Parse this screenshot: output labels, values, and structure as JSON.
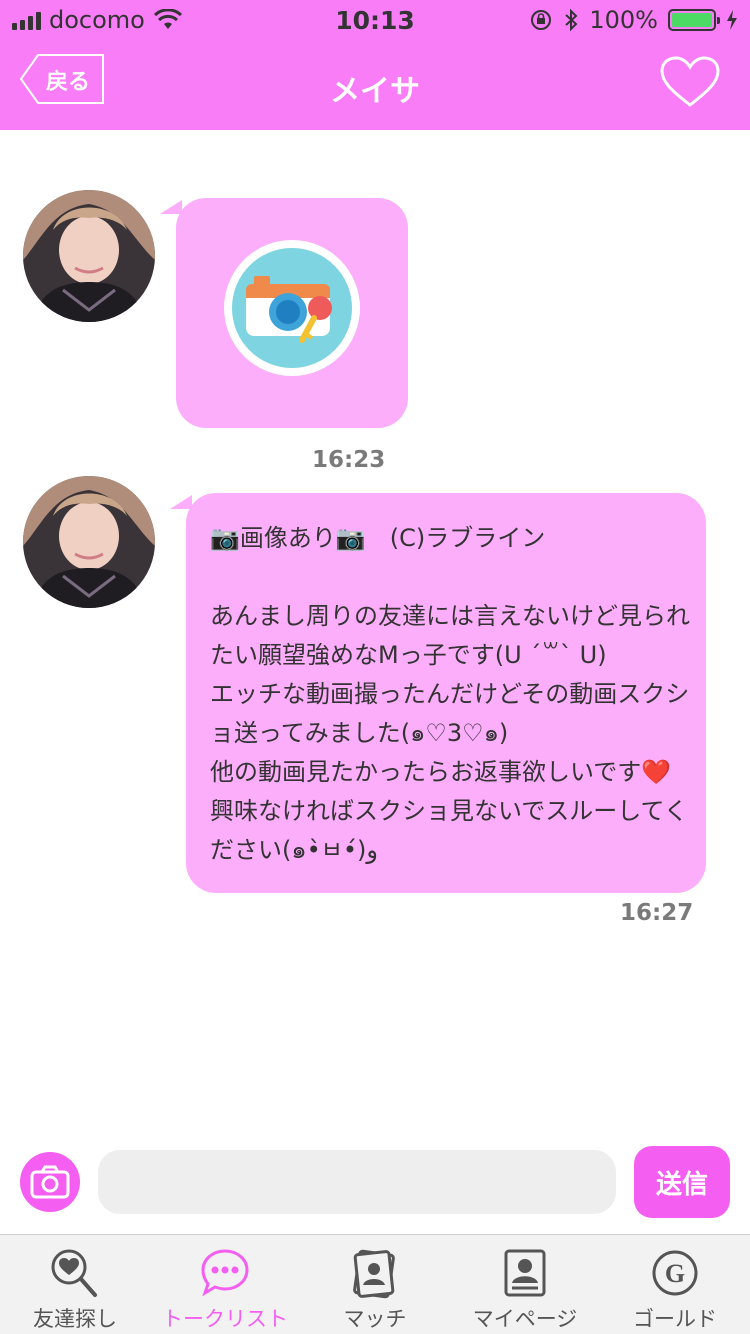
{
  "status_bar": {
    "carrier": "docomo",
    "time": "10:13",
    "battery_percent": "100%",
    "battery_level": 1.0
  },
  "nav": {
    "back_label": "戻る",
    "title": "メイサ",
    "favorite_icon": "heart-outline-icon"
  },
  "messages": [
    {
      "type": "image",
      "image_icon": "locked-camera-icon",
      "time": "16:23"
    },
    {
      "type": "text",
      "text": "📷画像あり📷　(C)ラブライン\n\nあんまし周りの友達には言えないけど見られたい願望強めなMっ子です(U ´꒳` U)\nエッチな動画撮ったんだけどその動画スクショ送ってみました(๑♡3♡๑)\n他の動画見たかったらお返事欲しいです❤️興味なければスクショ見ないでスルーしてください(๑•̀ㅂ•́)و",
      "time": "16:27"
    }
  ],
  "input_bar": {
    "camera_icon": "camera-icon",
    "message_value": "",
    "message_placeholder": "",
    "send_label": "送信"
  },
  "tabs": [
    {
      "label": "友達探し",
      "icon": "heart-search-icon",
      "active": false
    },
    {
      "label": "トークリスト",
      "icon": "chat-bubble-icon",
      "active": true
    },
    {
      "label": "マッチ",
      "icon": "cards-icon",
      "active": false
    },
    {
      "label": "マイページ",
      "icon": "profile-icon",
      "active": false
    },
    {
      "label": "ゴールド",
      "icon": "gold-coin-icon",
      "active": false
    }
  ],
  "colors": {
    "header_pink": "#f97df7",
    "bubble_pink": "#fcaefb",
    "accent_pink": "#f45ff2",
    "tab_bar_bg": "#f2f2f2"
  }
}
